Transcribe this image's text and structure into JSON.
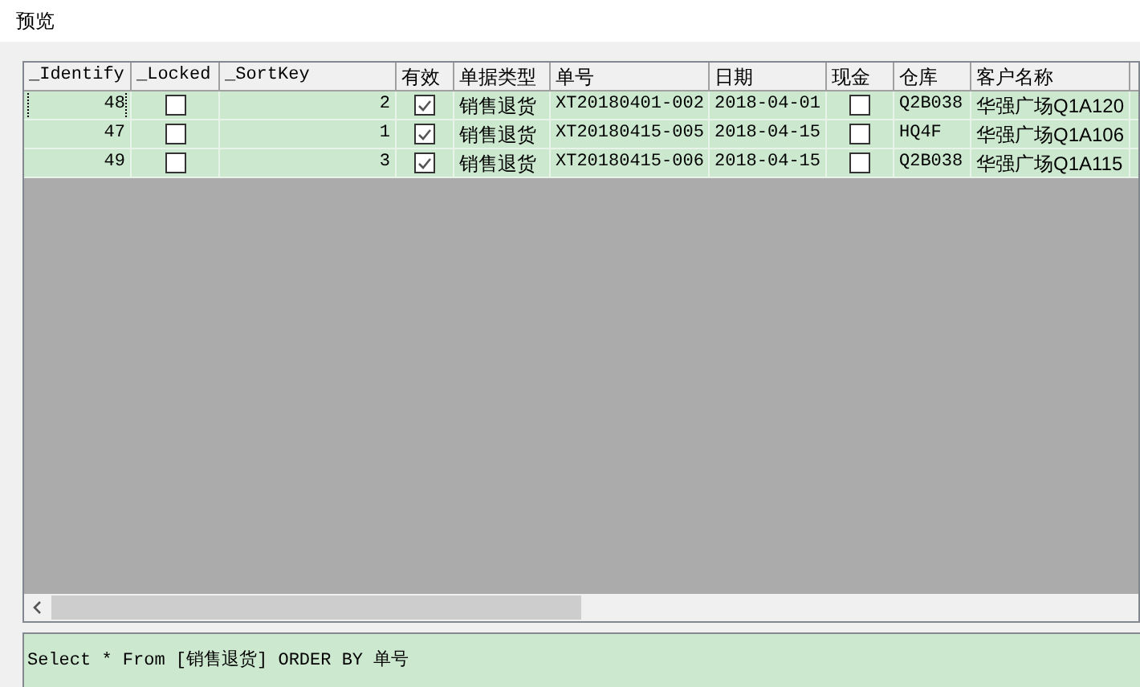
{
  "window": {
    "title": "预览"
  },
  "table": {
    "columns": [
      {
        "label": "_Identify",
        "kind": "number"
      },
      {
        "label": "_Locked",
        "kind": "check"
      },
      {
        "label": "_SortKey",
        "kind": "number"
      },
      {
        "label": "有效",
        "kind": "check"
      },
      {
        "label": "单据类型",
        "kind": "text"
      },
      {
        "label": "单号",
        "kind": "text"
      },
      {
        "label": "日期",
        "kind": "text"
      },
      {
        "label": "现金",
        "kind": "check"
      },
      {
        "label": "仓库",
        "kind": "text"
      },
      {
        "label": "客户名称",
        "kind": "text"
      }
    ],
    "rows": [
      {
        "focused": true,
        "cells": [
          "48",
          {
            "checked": false
          },
          "2",
          {
            "checked": true
          },
          "销售退货",
          "XT20180401-002",
          "2018-04-01",
          {
            "checked": false
          },
          "Q2B038",
          "华强广场Q1A120"
        ]
      },
      {
        "focused": false,
        "cells": [
          "47",
          {
            "checked": false
          },
          "1",
          {
            "checked": true
          },
          "销售退货",
          "XT20180415-005",
          "2018-04-15",
          {
            "checked": false
          },
          "HQ4F",
          "华强广场Q1A106"
        ]
      },
      {
        "focused": false,
        "cells": [
          "49",
          {
            "checked": false
          },
          "3",
          {
            "checked": true
          },
          "销售退货",
          "XT20180415-006",
          "2018-04-15",
          {
            "checked": false
          },
          "Q2B038",
          "华强广场Q1A115"
        ]
      }
    ]
  },
  "sql": {
    "value": "Select * From [销售退货] ORDER BY 单号"
  }
}
